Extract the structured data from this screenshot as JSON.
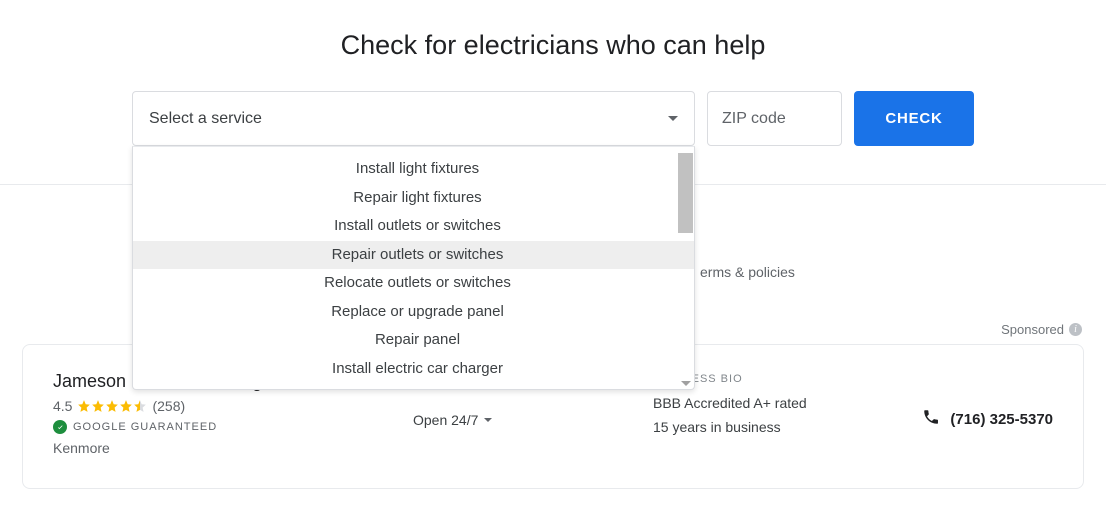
{
  "header": {
    "title": "Check for electricians who can help"
  },
  "search": {
    "service_placeholder": "Select a service",
    "zip_placeholder": "ZIP code",
    "check_label": "CHECK",
    "options": [
      {
        "label": "Install light fixtures",
        "highlighted": false
      },
      {
        "label": "Repair light fixtures",
        "highlighted": false
      },
      {
        "label": "Install outlets or switches",
        "highlighted": false
      },
      {
        "label": "Repair outlets or switches",
        "highlighted": true
      },
      {
        "label": "Relocate outlets or switches",
        "highlighted": false
      },
      {
        "label": "Replace or upgrade panel",
        "highlighted": false
      },
      {
        "label": "Repair panel",
        "highlighted": false
      },
      {
        "label": "Install electric car charger",
        "highlighted": false
      }
    ]
  },
  "footer_link": "erms & policies",
  "sponsored_label": "Sponsored",
  "listing": {
    "name": "Jameson Electric, Heating & Air",
    "rating_value": "4.5",
    "review_count": "(258)",
    "guarantee_label": "GOOGLE GUARANTEED",
    "location": "Kenmore",
    "hours": "Open 24/7",
    "bio_header": "BUSINESS BIO",
    "bio_line1": "BBB Accredited A+ rated",
    "bio_line2": "15 years in business",
    "phone": "(716) 325-5370"
  }
}
